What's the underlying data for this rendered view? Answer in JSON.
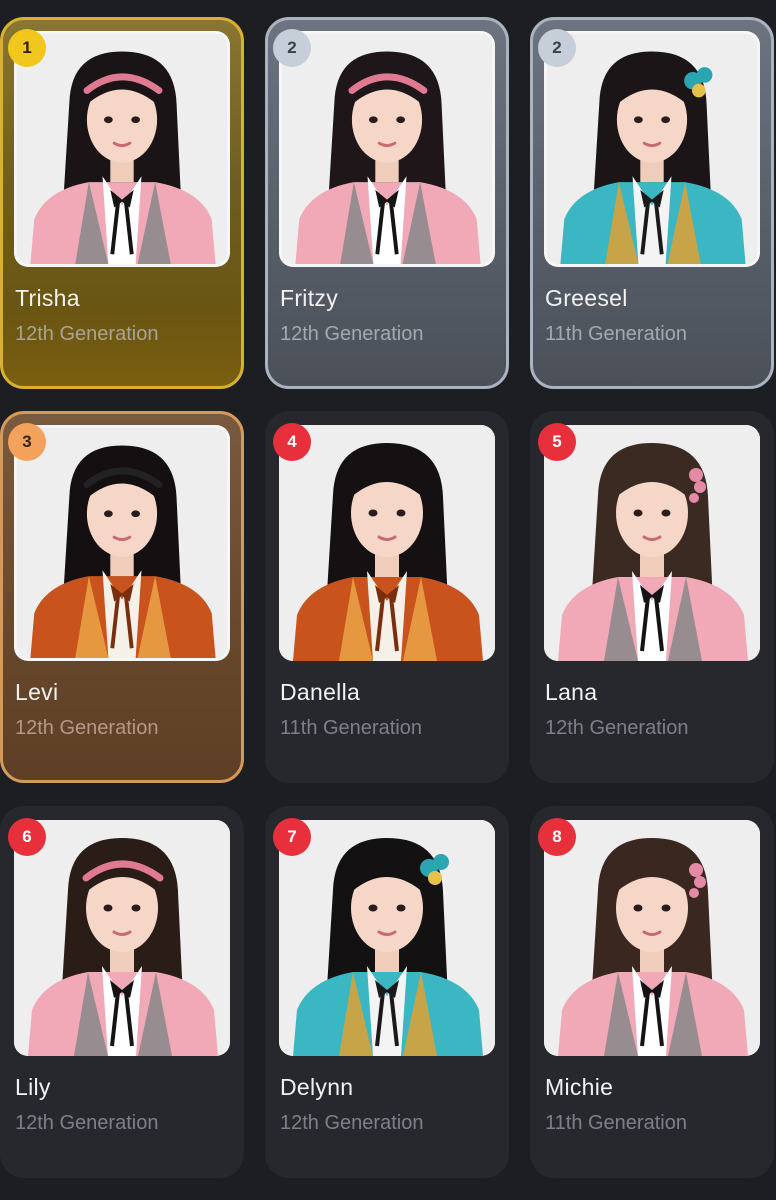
{
  "members": [
    {
      "rank": "1",
      "name": "Trisha",
      "generation": "12th Generation",
      "tier": "gold",
      "hair": "#1a1416",
      "accessory": "headband-pink",
      "outfit": "pink-uniform"
    },
    {
      "rank": "2",
      "name": "Fritzy",
      "generation": "12th Generation",
      "tier": "silver",
      "hair": "#1e1618",
      "accessory": "headband-pink",
      "outfit": "pink-uniform"
    },
    {
      "rank": "2",
      "name": "Greesel",
      "generation": "11th Generation",
      "tier": "silver",
      "hair": "#1b1517",
      "accessory": "hair-bow-teal",
      "outfit": "teal-costume"
    },
    {
      "rank": "3",
      "name": "Levi",
      "generation": "12th Generation",
      "tier": "bronze",
      "hair": "#141012",
      "accessory": "headband-black",
      "outfit": "orange-jacket"
    },
    {
      "rank": "4",
      "name": "Danella",
      "generation": "11th Generation",
      "tier": "plain",
      "hair": "#151113",
      "accessory": "none",
      "outfit": "orange-jacket"
    },
    {
      "rank": "5",
      "name": "Lana",
      "generation": "12th Generation",
      "tier": "plain",
      "hair": "#3a2a22",
      "accessory": "hair-clip-pink",
      "outfit": "pink-uniform"
    },
    {
      "rank": "6",
      "name": "Lily",
      "generation": "12th Generation",
      "tier": "plain",
      "hair": "#2a1d18",
      "accessory": "headband-pink",
      "outfit": "pink-uniform"
    },
    {
      "rank": "7",
      "name": "Delynn",
      "generation": "12th Generation",
      "tier": "plain",
      "hair": "#141113",
      "accessory": "hair-bow-teal",
      "outfit": "teal-costume"
    },
    {
      "rank": "8",
      "name": "Michie",
      "generation": "11th Generation",
      "tier": "plain",
      "hair": "#3a2820",
      "accessory": "hair-clip-pink",
      "outfit": "pink-uniform"
    }
  ],
  "colors": {
    "background": "#1c1e22",
    "card": "#26282d",
    "gold": "#d8b12e",
    "silver": "#aab3c0",
    "bronze": "#d59a5a",
    "rank_red": "#e8303c"
  }
}
